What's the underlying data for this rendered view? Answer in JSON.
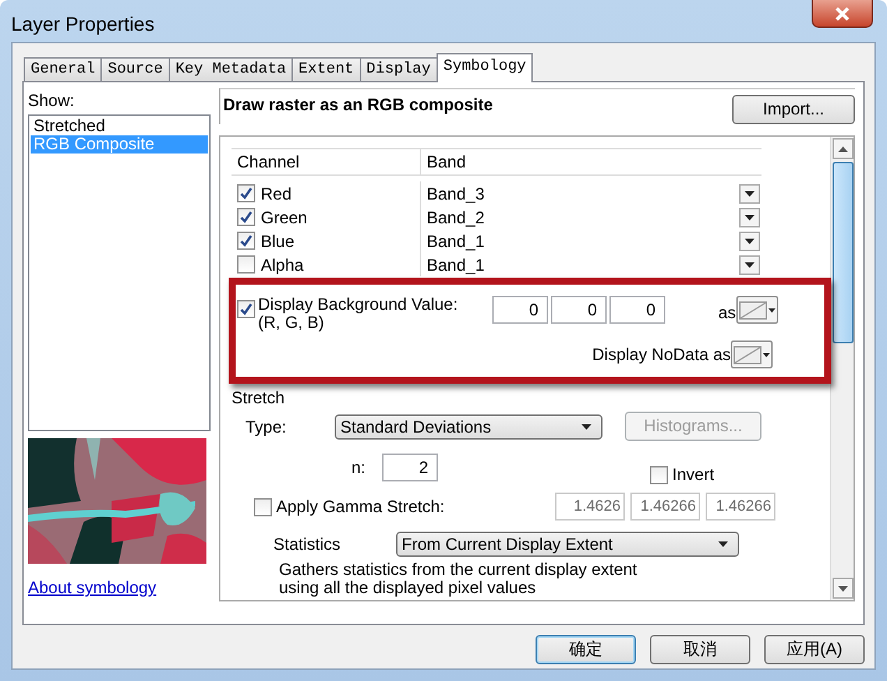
{
  "window": {
    "title": "Layer Properties"
  },
  "tabs": [
    {
      "label": "General",
      "selected": false
    },
    {
      "label": "Source",
      "selected": false
    },
    {
      "label": "Key Metadata",
      "selected": false
    },
    {
      "label": "Extent",
      "selected": false
    },
    {
      "label": "Display",
      "selected": false
    },
    {
      "label": "Symbology",
      "selected": true
    }
  ],
  "show": {
    "label": "Show:",
    "items": [
      {
        "label": "Stretched",
        "selected": false
      },
      {
        "label": "RGB Composite",
        "selected": true
      }
    ]
  },
  "about_link": "About symbology",
  "heading": "Draw raster as an RGB composite",
  "import_button": "Import...",
  "channels": {
    "columns": [
      "Channel",
      "Band"
    ],
    "rows": [
      {
        "channel": "Red",
        "checked": true,
        "band": "Band_3"
      },
      {
        "channel": "Green",
        "checked": true,
        "band": "Band_2"
      },
      {
        "channel": "Blue",
        "checked": true,
        "band": "Band_1"
      },
      {
        "channel": "Alpha",
        "checked": false,
        "band": "Band_1"
      }
    ]
  },
  "background": {
    "label": "Display Background Value:(R, G, B)",
    "checked": true,
    "values": [
      "0",
      "0",
      "0"
    ],
    "as_label": "as"
  },
  "nodata": {
    "label": "Display NoData as"
  },
  "stretch": {
    "title": "Stretch",
    "type_label": "Type:",
    "type_value": "Standard Deviations",
    "histograms_button": {
      "label": "Histograms...",
      "disabled": true
    },
    "n_label": "n:",
    "n_value": "2",
    "invert": {
      "label": "Invert",
      "checked": false
    },
    "gamma": {
      "label": "Apply Gamma Stretch:",
      "checked": false,
      "values": [
        "1.4626",
        "1.46266",
        "1.46266"
      ]
    }
  },
  "statistics": {
    "label": "Statistics",
    "value": "From Current Display Extent",
    "description": "Gathers statistics from the current display extent using all the displayed pixel values"
  },
  "buttons": [
    {
      "label": "确定",
      "default": true
    },
    {
      "label": "取消",
      "default": false
    },
    {
      "label": "应用(A)",
      "default": false
    }
  ]
}
